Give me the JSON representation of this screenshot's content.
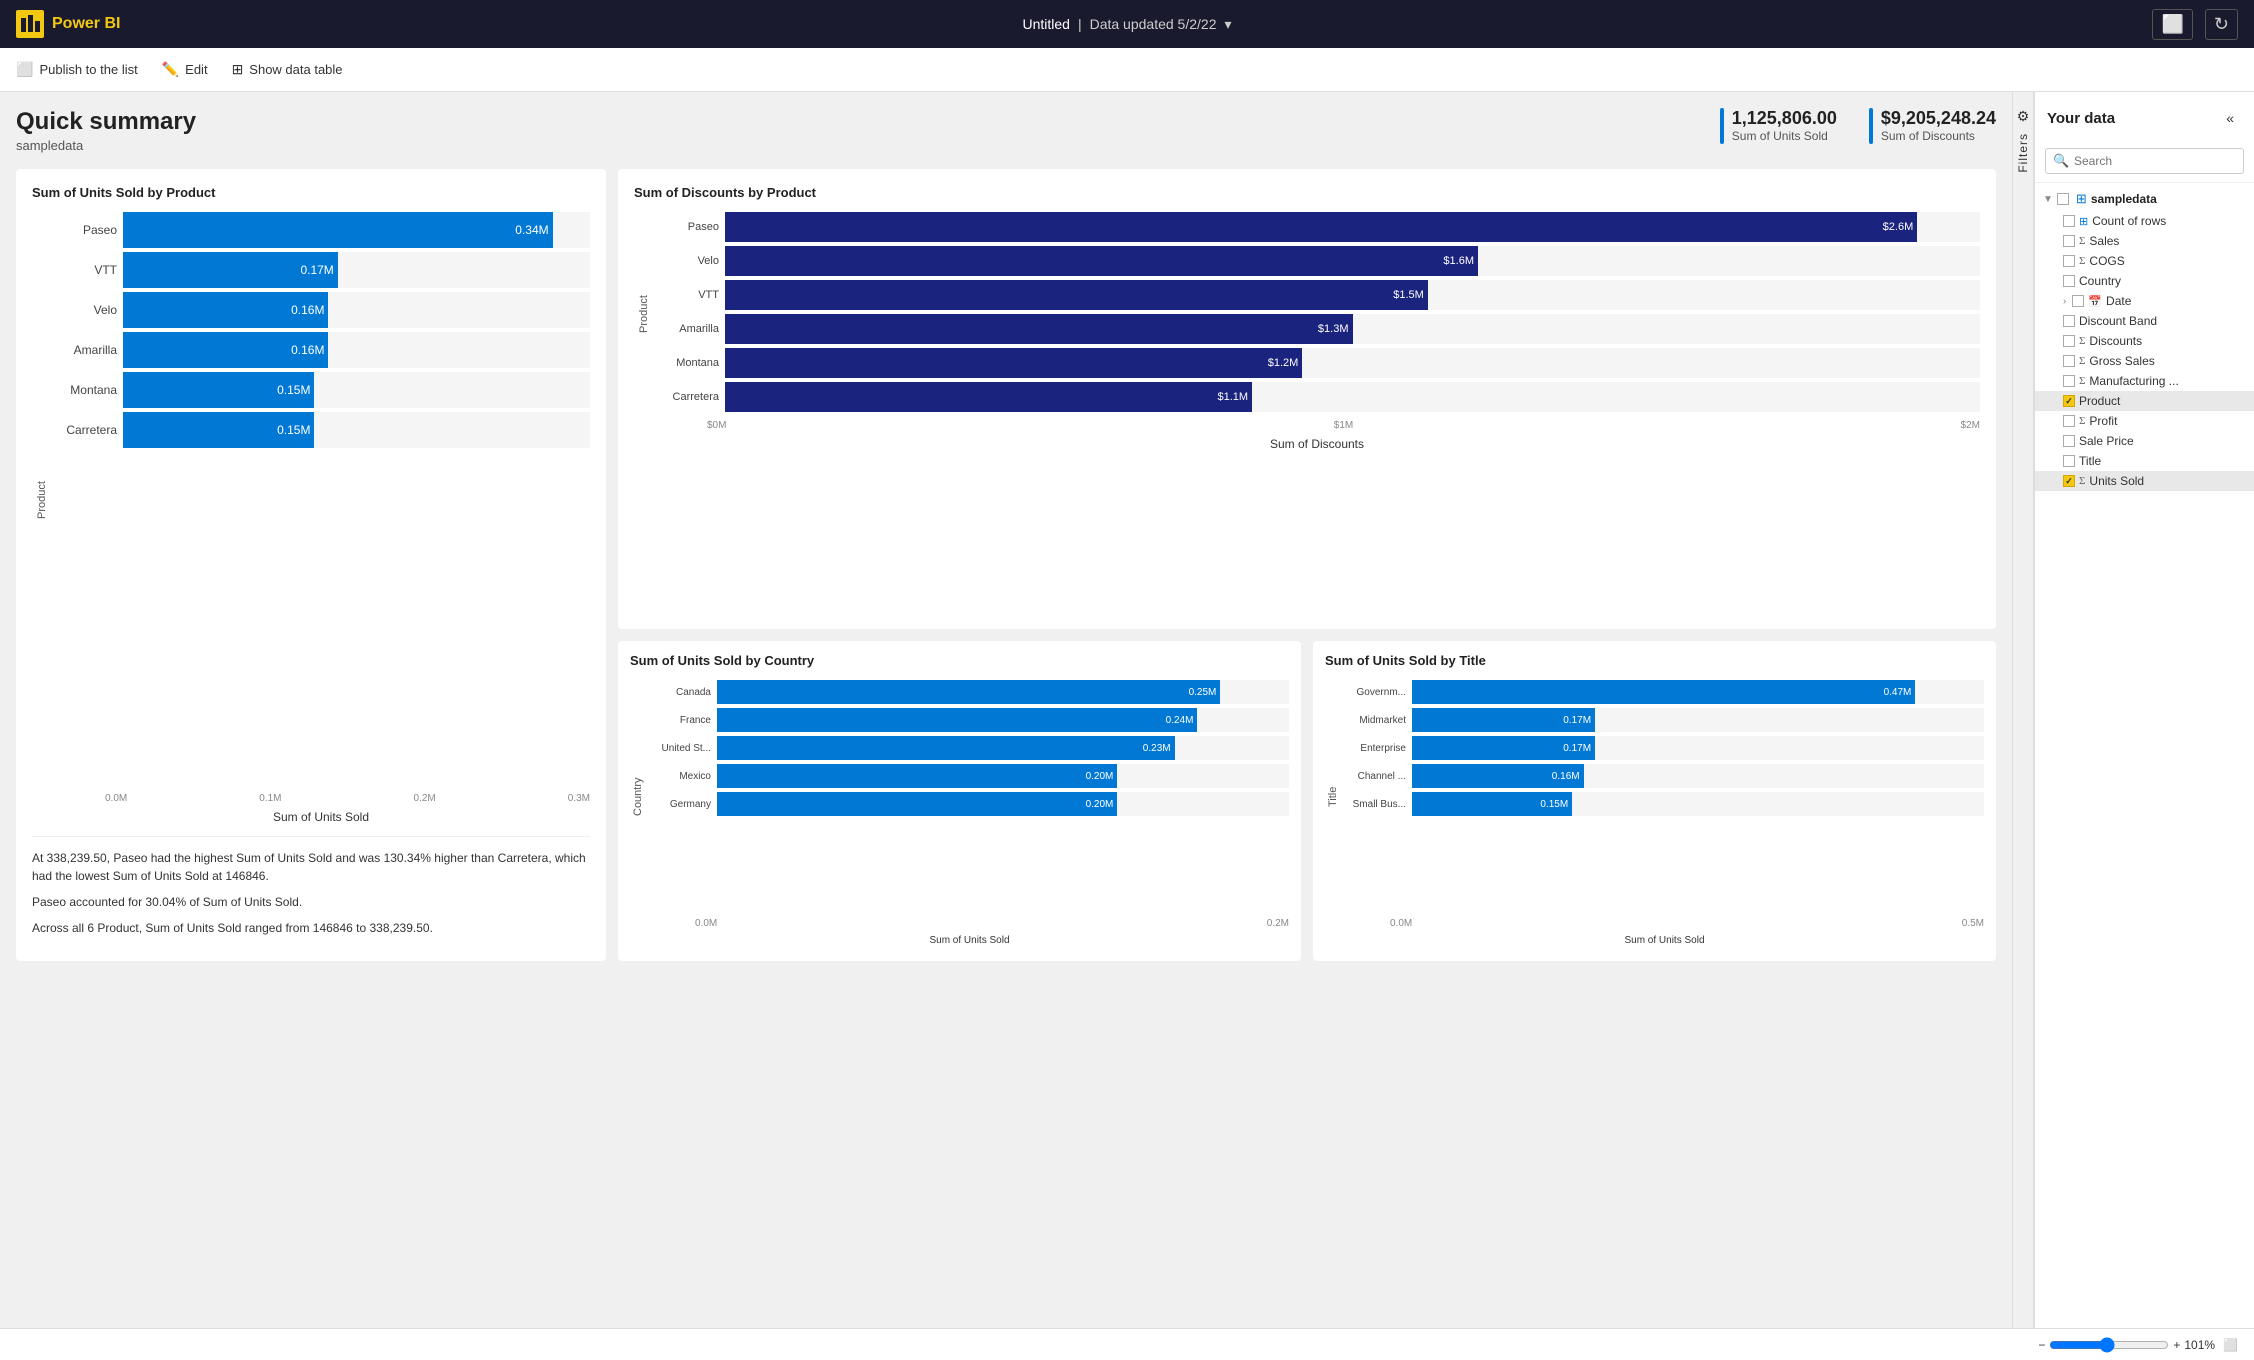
{
  "topbar": {
    "logo": "Power BI",
    "title": "Untitled",
    "subtitle": "Data updated 5/2/22",
    "dropdown_icon": "▾"
  },
  "toolbar": {
    "publish_label": "Publish to the list",
    "edit_label": "Edit",
    "show_data_table_label": "Show data table"
  },
  "page": {
    "title": "Quick summary",
    "subtitle": "sampledata",
    "kpi1_value": "1,125,806.00",
    "kpi1_label": "Sum of Units Sold",
    "kpi2_value": "$9,205,248.24",
    "kpi2_label": "Sum of Discounts"
  },
  "chart1": {
    "title": "Sum of Units Sold by Product",
    "x_label": "Sum of Units Sold",
    "y_label": "Product",
    "x_axis": [
      "0.0M",
      "0.1M",
      "0.2M",
      "0.3M"
    ],
    "bars": [
      {
        "label": "Paseo",
        "value": "0.34M",
        "pct": 92
      },
      {
        "label": "VTT",
        "value": "0.17M",
        "pct": 46
      },
      {
        "label": "Velo",
        "value": "0.16M",
        "pct": 44
      },
      {
        "label": "Amarilla",
        "value": "0.16M",
        "pct": 44
      },
      {
        "label": "Montana",
        "value": "0.15M",
        "pct": 41
      },
      {
        "label": "Carretera",
        "value": "0.15M",
        "pct": 41
      }
    ],
    "insights": [
      "At 338,239.50, Paseo had the highest Sum of Units Sold and was 130.34% higher than Carretera, which had the lowest Sum of Units Sold at 146846.",
      "Paseo accounted for 30.04% of Sum of Units Sold.",
      "Across all 6 Product, Sum of Units Sold ranged from 146846 to 338,239.50."
    ]
  },
  "chart2": {
    "title": "Sum of Discounts by Product",
    "x_label": "Sum of Discounts",
    "y_label": "Product",
    "x_axis": [
      "$0M",
      "$1M",
      "$2M"
    ],
    "bars": [
      {
        "label": "Paseo",
        "value": "$2.6M",
        "pct": 95
      },
      {
        "label": "Velo",
        "value": "$1.6M",
        "pct": 60
      },
      {
        "label": "VTT",
        "value": "$1.5M",
        "pct": 56
      },
      {
        "label": "Amarilla",
        "value": "$1.3M",
        "pct": 50
      },
      {
        "label": "Montana",
        "value": "$1.2M",
        "pct": 46
      },
      {
        "label": "Carretera",
        "value": "$1.1M",
        "pct": 42
      }
    ]
  },
  "chart3": {
    "title": "Sum of Units Sold by Country",
    "x_label": "Sum of Units Sold",
    "y_label": "Country",
    "x_axis": [
      "0.0M",
      "0.2M"
    ],
    "bars": [
      {
        "label": "Canada",
        "value": "0.25M",
        "pct": 88
      },
      {
        "label": "France",
        "value": "0.24M",
        "pct": 84
      },
      {
        "label": "United St...",
        "value": "0.23M",
        "pct": 80
      },
      {
        "label": "Mexico",
        "value": "0.20M",
        "pct": 70
      },
      {
        "label": "Germany",
        "value": "0.20M",
        "pct": 70
      }
    ]
  },
  "chart4": {
    "title": "Sum of Units Sold by Title",
    "x_label": "Sum of Units Sold",
    "y_label": "Title",
    "x_axis": [
      "0.0M",
      "0.5M"
    ],
    "bars": [
      {
        "label": "Governm...",
        "value": "0.47M",
        "pct": 88
      },
      {
        "label": "Midmarket",
        "value": "0.17M",
        "pct": 32
      },
      {
        "label": "Enterprise",
        "value": "0.17M",
        "pct": 32
      },
      {
        "label": "Channel ...",
        "value": "0.16M",
        "pct": 30
      },
      {
        "label": "Small Bus...",
        "value": "0.15M",
        "pct": 28
      }
    ]
  },
  "sidebar": {
    "title": "Your data",
    "search_placeholder": "Search",
    "group_name": "sampledata",
    "items": [
      {
        "name": "Count of rows",
        "type": "count",
        "checked": false
      },
      {
        "name": "Sales",
        "type": "sigma",
        "checked": false
      },
      {
        "name": "COGS",
        "type": "sigma",
        "checked": false
      },
      {
        "name": "Country",
        "type": "field",
        "checked": false
      },
      {
        "name": "Date",
        "type": "calendar",
        "checked": false,
        "expandable": true
      },
      {
        "name": "Discount Band",
        "type": "field",
        "checked": false
      },
      {
        "name": "Discounts",
        "type": "sigma",
        "checked": false
      },
      {
        "name": "Gross Sales",
        "type": "sigma",
        "checked": false
      },
      {
        "name": "Manufacturing ...",
        "type": "sigma",
        "checked": false
      },
      {
        "name": "Product",
        "type": "field",
        "checked": true,
        "highlighted": true
      },
      {
        "name": "Profit",
        "type": "sigma",
        "checked": false
      },
      {
        "name": "Sale Price",
        "type": "field",
        "checked": false
      },
      {
        "name": "Title",
        "type": "field",
        "checked": false
      },
      {
        "name": "Units Sold",
        "type": "sigma",
        "checked": true,
        "highlighted": true
      }
    ]
  },
  "bottombar": {
    "zoom": "101%"
  },
  "filters_tab_label": "Filters"
}
